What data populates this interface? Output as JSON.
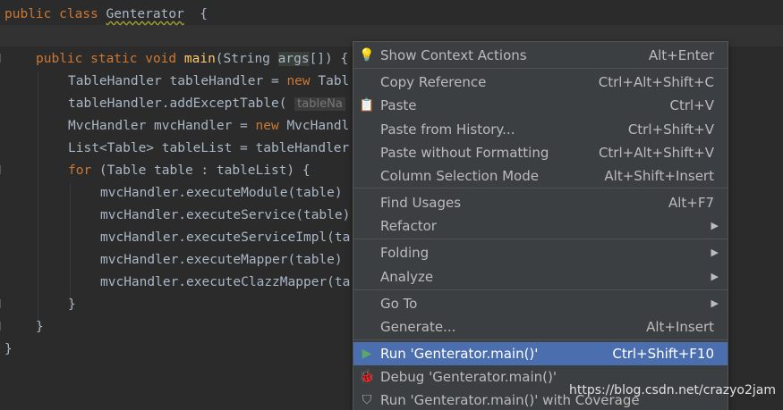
{
  "editor": {
    "lines": [
      {
        "parts": [
          [
            "kw",
            "public class "
          ],
          [
            "sq",
            "Genterator"
          ],
          [
            "",
            "  {"
          ]
        ]
      },
      {
        "parts": [
          [
            "kw",
            "public static void "
          ],
          [
            "fn",
            "main"
          ],
          [
            "",
            "(String "
          ],
          [
            "hl",
            "args"
          ],
          [
            "",
            "[]) {"
          ]
        ]
      },
      {
        "parts": [
          [
            "",
            "TableHandler tableHandler = "
          ],
          [
            "kw",
            "new "
          ],
          [
            "",
            "Tabl"
          ]
        ]
      },
      {
        "parts": [
          [
            "",
            "tableHandler.addExceptTable( "
          ],
          [
            "hint",
            "tableNa"
          ]
        ]
      },
      {
        "parts": [
          [
            "",
            "MvcHandler mvcHandler = "
          ],
          [
            "kw",
            "new "
          ],
          [
            "",
            "MvcHandl"
          ]
        ]
      },
      {
        "parts": [
          [
            "",
            "List<Table> tableList = tableHandler"
          ]
        ]
      },
      {
        "parts": [
          [
            "kw",
            "for "
          ],
          [
            "",
            "(Table table : tableList) {"
          ]
        ]
      },
      {
        "parts": [
          [
            "",
            "mvcHandler.executeModule(table)"
          ]
        ]
      },
      {
        "parts": [
          [
            "",
            "mvcHandler.executeService(table)"
          ]
        ]
      },
      {
        "parts": [
          [
            "",
            "mvcHandler.executeServiceImpl(ta"
          ]
        ]
      },
      {
        "parts": [
          [
            "",
            "mvcHandler.executeMapper(table)"
          ]
        ]
      },
      {
        "parts": [
          [
            "",
            "mvcHandler.executeClazzMapper(ta"
          ]
        ]
      },
      {
        "parts": [
          [
            "",
            "}"
          ]
        ]
      },
      {
        "parts": [
          [
            "",
            "}"
          ]
        ]
      },
      {
        "parts": [
          [
            "",
            "}"
          ]
        ]
      }
    ]
  },
  "context_menu": {
    "items": [
      {
        "label": "Show Context Actions",
        "shortcut": "Alt+Enter",
        "icon": "lightbulb-icon",
        "glyph": "💡"
      },
      {
        "label": "Copy Reference",
        "shortcut": "Ctrl+Alt+Shift+C"
      },
      {
        "label": "Paste",
        "shortcut": "Ctrl+V",
        "icon": "clipboard-icon",
        "glyph": "📋"
      },
      {
        "label": "Paste from History...",
        "shortcut": "Ctrl+Shift+V"
      },
      {
        "label": "Paste without Formatting",
        "shortcut": "Ctrl+Alt+Shift+V"
      },
      {
        "label": "Column Selection Mode",
        "shortcut": "Alt+Shift+Insert"
      },
      {
        "label": "Find Usages",
        "shortcut": "Alt+F7"
      },
      {
        "label": "Refactor",
        "submenu": true
      },
      {
        "label": "Folding",
        "submenu": true
      },
      {
        "label": "Analyze",
        "submenu": true
      },
      {
        "label": "Go To",
        "submenu": true
      },
      {
        "label": "Generate...",
        "shortcut": "Alt+Insert"
      },
      {
        "label": "Run 'Genterator.main()'",
        "shortcut": "Ctrl+Shift+F10",
        "icon": "run-icon",
        "glyph": "▶",
        "selected": true
      },
      {
        "label": "Debug 'Genterator.main()'",
        "icon": "debug-icon",
        "glyph": "🐞"
      },
      {
        "label": "Run 'Genterator.main()' with Coverage",
        "icon": "coverage-icon",
        "glyph": "⛉"
      }
    ],
    "submenu_arrow": "▶"
  },
  "watermark": "https://blog.csdn.net/crazyo2jam",
  "colors": {
    "editor_bg": "#2b2b2b",
    "keyword": "#cc7832",
    "function": "#ffc66d",
    "text": "#a9b7c6",
    "menu_bg": "#3c3f41",
    "menu_selected": "#4b6eaf"
  }
}
